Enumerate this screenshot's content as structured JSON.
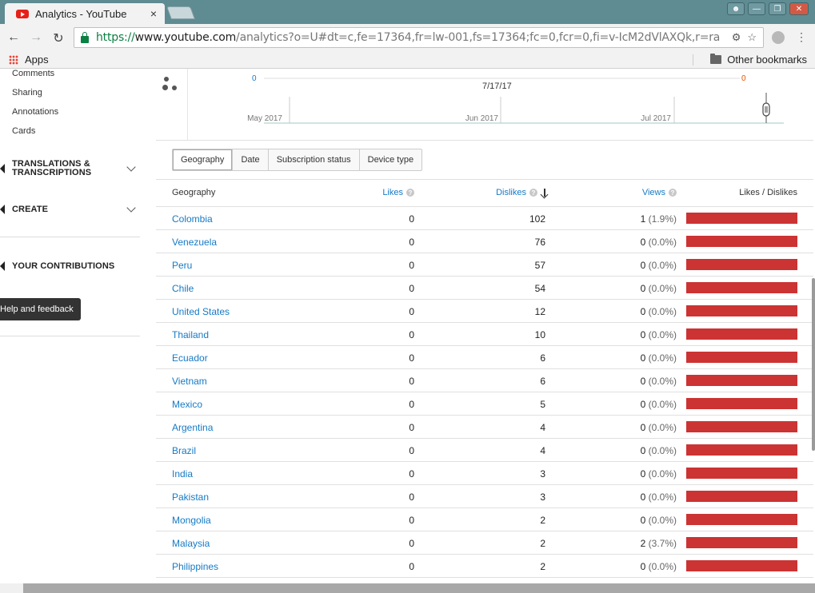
{
  "browser": {
    "tab_title": "Analytics - YouTube",
    "tab_close": "×",
    "url_scheme": "https://",
    "url_host": "www.youtube.com",
    "url_path": "/analytics?o=U#dt=c,fe=17364,fr=lw-001,fs=17364;fc=0,fcr=0,fi=v-IcM2dVlAXQk,r=ra",
    "nav": {
      "back": "←",
      "forward": "→",
      "reload": "↻"
    },
    "icons": {
      "star": "☆",
      "menu": "⋮"
    }
  },
  "bookmarks": {
    "apps_label": "Apps",
    "other_label": "Other bookmarks"
  },
  "sidebar": {
    "sub_items": [
      "Comments",
      "Sharing",
      "Annotations",
      "Cards"
    ],
    "translations_label_1": "TRANSLATIONS &",
    "translations_label_2": "TRANSCRIPTIONS",
    "create_label": "CREATE",
    "contributions_label": "YOUR CONTRIBUTIONS",
    "help_label": "Help and feedback"
  },
  "chart": {
    "left_value": "0",
    "right_value": "0",
    "date_label": "7/17/17",
    "months": [
      "May 2017",
      "Jun 2017",
      "Jul 2017"
    ],
    "colors": {
      "left": "#167ac6",
      "right": "#e65100"
    }
  },
  "tabs": [
    "Geography",
    "Date",
    "Subscription status",
    "Device type"
  ],
  "active_tab": "Geography",
  "table": {
    "headers": {
      "geography": "Geography",
      "likes": "Likes",
      "dislikes": "Dislikes",
      "views": "Views",
      "ratio": "Likes / Dislikes"
    },
    "help_mark": "?",
    "rows": [
      {
        "geo": "Colombia",
        "likes": "0",
        "dislikes": "102",
        "views": "1",
        "views_pct": "(1.9%)"
      },
      {
        "geo": "Venezuela",
        "likes": "0",
        "dislikes": "76",
        "views": "0",
        "views_pct": "(0.0%)"
      },
      {
        "geo": "Peru",
        "likes": "0",
        "dislikes": "57",
        "views": "0",
        "views_pct": "(0.0%)"
      },
      {
        "geo": "Chile",
        "likes": "0",
        "dislikes": "54",
        "views": "0",
        "views_pct": "(0.0%)"
      },
      {
        "geo": "United States",
        "likes": "0",
        "dislikes": "12",
        "views": "0",
        "views_pct": "(0.0%)"
      },
      {
        "geo": "Thailand",
        "likes": "0",
        "dislikes": "10",
        "views": "0",
        "views_pct": "(0.0%)"
      },
      {
        "geo": "Ecuador",
        "likes": "0",
        "dislikes": "6",
        "views": "0",
        "views_pct": "(0.0%)"
      },
      {
        "geo": "Vietnam",
        "likes": "0",
        "dislikes": "6",
        "views": "0",
        "views_pct": "(0.0%)"
      },
      {
        "geo": "Mexico",
        "likes": "0",
        "dislikes": "5",
        "views": "0",
        "views_pct": "(0.0%)"
      },
      {
        "geo": "Argentina",
        "likes": "0",
        "dislikes": "4",
        "views": "0",
        "views_pct": "(0.0%)"
      },
      {
        "geo": "Brazil",
        "likes": "0",
        "dislikes": "4",
        "views": "0",
        "views_pct": "(0.0%)"
      },
      {
        "geo": "India",
        "likes": "0",
        "dislikes": "3",
        "views": "0",
        "views_pct": "(0.0%)"
      },
      {
        "geo": "Pakistan",
        "likes": "0",
        "dislikes": "3",
        "views": "0",
        "views_pct": "(0.0%)"
      },
      {
        "geo": "Mongolia",
        "likes": "0",
        "dislikes": "2",
        "views": "0",
        "views_pct": "(0.0%)"
      },
      {
        "geo": "Malaysia",
        "likes": "0",
        "dislikes": "2",
        "views": "2",
        "views_pct": "(3.7%)"
      },
      {
        "geo": "Philippines",
        "likes": "0",
        "dislikes": "2",
        "views": "0",
        "views_pct": "(0.0%)"
      }
    ],
    "colors": {
      "link": "#167ac6",
      "like": "#167ac6",
      "dislike": "#cc3333"
    }
  }
}
